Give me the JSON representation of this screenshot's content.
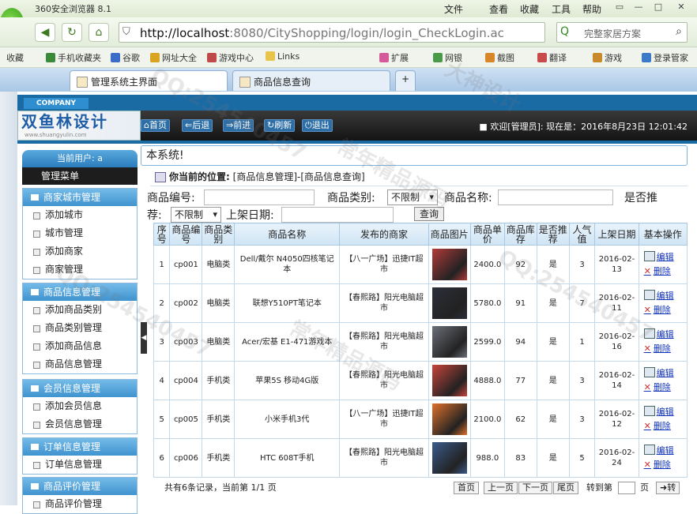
{
  "browser": {
    "title": "360安全浏览器 8.1",
    "menu": [
      "文件",
      "查看",
      "收藏",
      "工具",
      "帮助"
    ],
    "url_host": "http://localhost",
    "url_path": ":8080/CityShopping/login/login_CheckLogin.actio",
    "search_placeholder": "完整家居方案",
    "bookmarks": [
      "收藏",
      "手机收藏夹",
      "谷歌",
      "网址大全",
      "游戏中心",
      "Links",
      "扩展",
      "网银",
      "截图",
      "翻译",
      "游戏",
      "登录管家"
    ],
    "tabs": [
      "管理系统主界面",
      "商品信息查询"
    ]
  },
  "header": {
    "company": "COMPANY",
    "brand_cn": "双鱼林设计",
    "brand_en": "www.shuangyulin.com",
    "buttons": [
      "首页",
      "后退",
      "前进",
      "刷新",
      "退出"
    ],
    "welcome": "欢迎[管理员]:   现在是：2016年8月23日 12:01:42"
  },
  "sidebar": {
    "user": "当前用户: a",
    "menu_title": "管理菜单",
    "sections": [
      {
        "title": "商家城市管理",
        "items": [
          "添加城市",
          "城市管理",
          "添加商家",
          "商家管理"
        ]
      },
      {
        "title": "商品信息管理",
        "items": [
          "添加商品类别",
          "商品类别管理",
          "添加商品信息",
          "商品信息管理"
        ]
      },
      {
        "title": "会员信息管理",
        "items": [
          "添加会员信息",
          "会员信息管理"
        ]
      },
      {
        "title": "订单信息管理",
        "items": [
          "订单信息管理"
        ]
      },
      {
        "title": "商品评价管理",
        "items": [
          "商品评价管理"
        ]
      }
    ]
  },
  "main": {
    "system_line": "本系统!",
    "crumb_label": "你当前的位置:",
    "crumb_path": "[商品信息管理]-[商品信息查询]",
    "filters": {
      "code_label": "商品编号:",
      "type_label": "商品类别:",
      "type_value": "不限制",
      "name_label": "商品名称:",
      "recommend_label_1": "是否推",
      "recommend_label_2": "荐:",
      "recommend_value": "不限制",
      "date_label": "上架日期:",
      "query_button": "查询"
    },
    "columns": [
      "序号",
      "商品编号",
      "商品类别",
      "商品名称",
      "发布的商家",
      "商品图片",
      "商品单价",
      "商品库存",
      "是否推荐",
      "人气值",
      "上架日期",
      "基本操作"
    ],
    "rows": [
      {
        "no": "1",
        "code": "cp001",
        "type": "电脑类",
        "name": "Dell/戴尔 N4050四核笔记本",
        "shop": "【八一广场】迅捷IT超市",
        "price": "2400.0",
        "stock": "92",
        "rec": "是",
        "pop": "3",
        "date": "2016-02-13",
        "img_color": "#b23a3a"
      },
      {
        "no": "2",
        "code": "cp002",
        "type": "电脑类",
        "name": "联想Y510PT笔记本",
        "shop": "【春熙路】阳光电脑超市",
        "price": "5780.0",
        "stock": "91",
        "rec": "是",
        "pop": "7",
        "date": "2016-02-11",
        "img_color": "#2b2f3a"
      },
      {
        "no": "3",
        "code": "cp003",
        "type": "电脑类",
        "name": "Acer/宏基 E1-471游戏本",
        "shop": "【春熙路】阳光电脑超市",
        "price": "2599.0",
        "stock": "94",
        "rec": "是",
        "pop": "1",
        "date": "2016-02-16",
        "img_color": "#6b6f78"
      },
      {
        "no": "4",
        "code": "cp004",
        "type": "手机类",
        "name": "苹果5S 移动4G版",
        "shop": "【春熙路】阳光电脑超市",
        "price": "4888.0",
        "stock": "77",
        "rec": "是",
        "pop": "3",
        "date": "2016-02-14",
        "img_color": "#c8443a"
      },
      {
        "no": "5",
        "code": "cp005",
        "type": "手机类",
        "name": "小米手机3代",
        "shop": "【八一广场】迅捷IT超市",
        "price": "2100.0",
        "stock": "62",
        "rec": "是",
        "pop": "3",
        "date": "2016-02-12",
        "img_color": "#e0712b"
      },
      {
        "no": "6",
        "code": "cp006",
        "type": "手机类",
        "name": "HTC 608T手机",
        "shop": "【春熙路】阳光电脑超市",
        "price": "988.0",
        "stock": "83",
        "rec": "是",
        "pop": "5",
        "date": "2016-02-24",
        "img_color": "#3a5b8c"
      }
    ],
    "edit_label": "编辑",
    "delete_label": "删除",
    "pager": {
      "summary": "共有6条记录，当前第 1/1 页",
      "first": "首页",
      "prev": "上一页",
      "next": "下一页",
      "last": "尾页",
      "goto_label": "转到第",
      "page_unit": "页",
      "go": "转"
    }
  },
  "watermarks": [
    "QQ:254540457",
    "常年精品源码",
    "大神设计"
  ]
}
